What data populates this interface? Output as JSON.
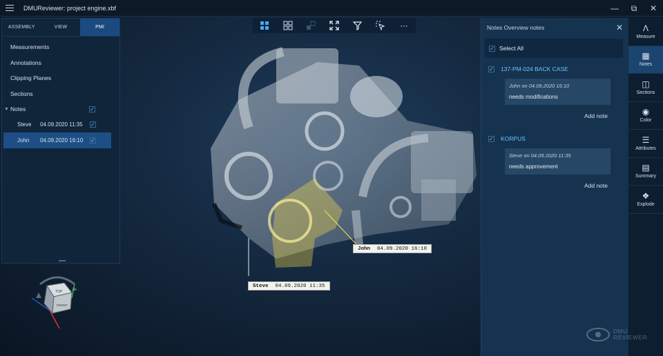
{
  "app": {
    "title": "DMUReviewer:  project engine.xbf",
    "controls": [
      "minimize",
      "restore",
      "close"
    ]
  },
  "left_panel": {
    "tabs": [
      {
        "label": "ASSEMBLY",
        "active": false
      },
      {
        "label": "VIEW",
        "active": false
      },
      {
        "label": "PMI",
        "active": true
      }
    ],
    "items": [
      "Measurements",
      "Annotations",
      "Clipping Planes",
      "Sections"
    ],
    "notes": {
      "label": "Notes",
      "entries": [
        {
          "name": "Steve",
          "date": "04.09.2020 11:35",
          "selected": false
        },
        {
          "name": "John",
          "date": "04.09.2020 16:10",
          "selected": true
        }
      ]
    }
  },
  "toolbar": {
    "icons": [
      "layout-grid-icon",
      "layout-quad-icon",
      "layout-single-icon",
      "fit-view-icon",
      "filter-icon",
      "select-icon",
      "more-icon"
    ]
  },
  "viewport": {
    "callouts": [
      {
        "name": "John",
        "date": "04.09.2020 16:10"
      },
      {
        "name": "Steve",
        "date": "04.09.2020 11:35"
      }
    ]
  },
  "notes_overview": {
    "title": "Notes Overview notes",
    "select_all": "Select All",
    "groups": [
      {
        "part": "137-PM-024 BACK CASE",
        "author": "John",
        "on": "on",
        "date": "04.09.2020 16:10",
        "text": "needs modifications",
        "add_note": "Add note"
      },
      {
        "part": "KORPUS",
        "author": "Steve",
        "on": "on",
        "date": "04.09.2020 11:35",
        "text": "needs approvement",
        "add_note": "Add note"
      }
    ]
  },
  "right_bar": {
    "items": [
      {
        "label": "Measure",
        "icon": "measure-icon"
      },
      {
        "label": "Notes",
        "icon": "notes-icon",
        "active": true
      },
      {
        "label": "Sections",
        "icon": "sections-icon"
      },
      {
        "label": "Color",
        "icon": "palette-icon"
      },
      {
        "label": "Attributes",
        "icon": "attributes-icon"
      },
      {
        "label": "Summary",
        "icon": "summary-icon"
      },
      {
        "label": "Explode",
        "icon": "explode-icon"
      }
    ]
  },
  "logo": {
    "line1": "DMU",
    "line2": "REVIEWER"
  },
  "navcube": {
    "top": "TOP",
    "front": "FRONT"
  },
  "colors": {
    "accent": "#6cc4ff",
    "highlight": "#ffe14a",
    "panel": "#15324f"
  }
}
